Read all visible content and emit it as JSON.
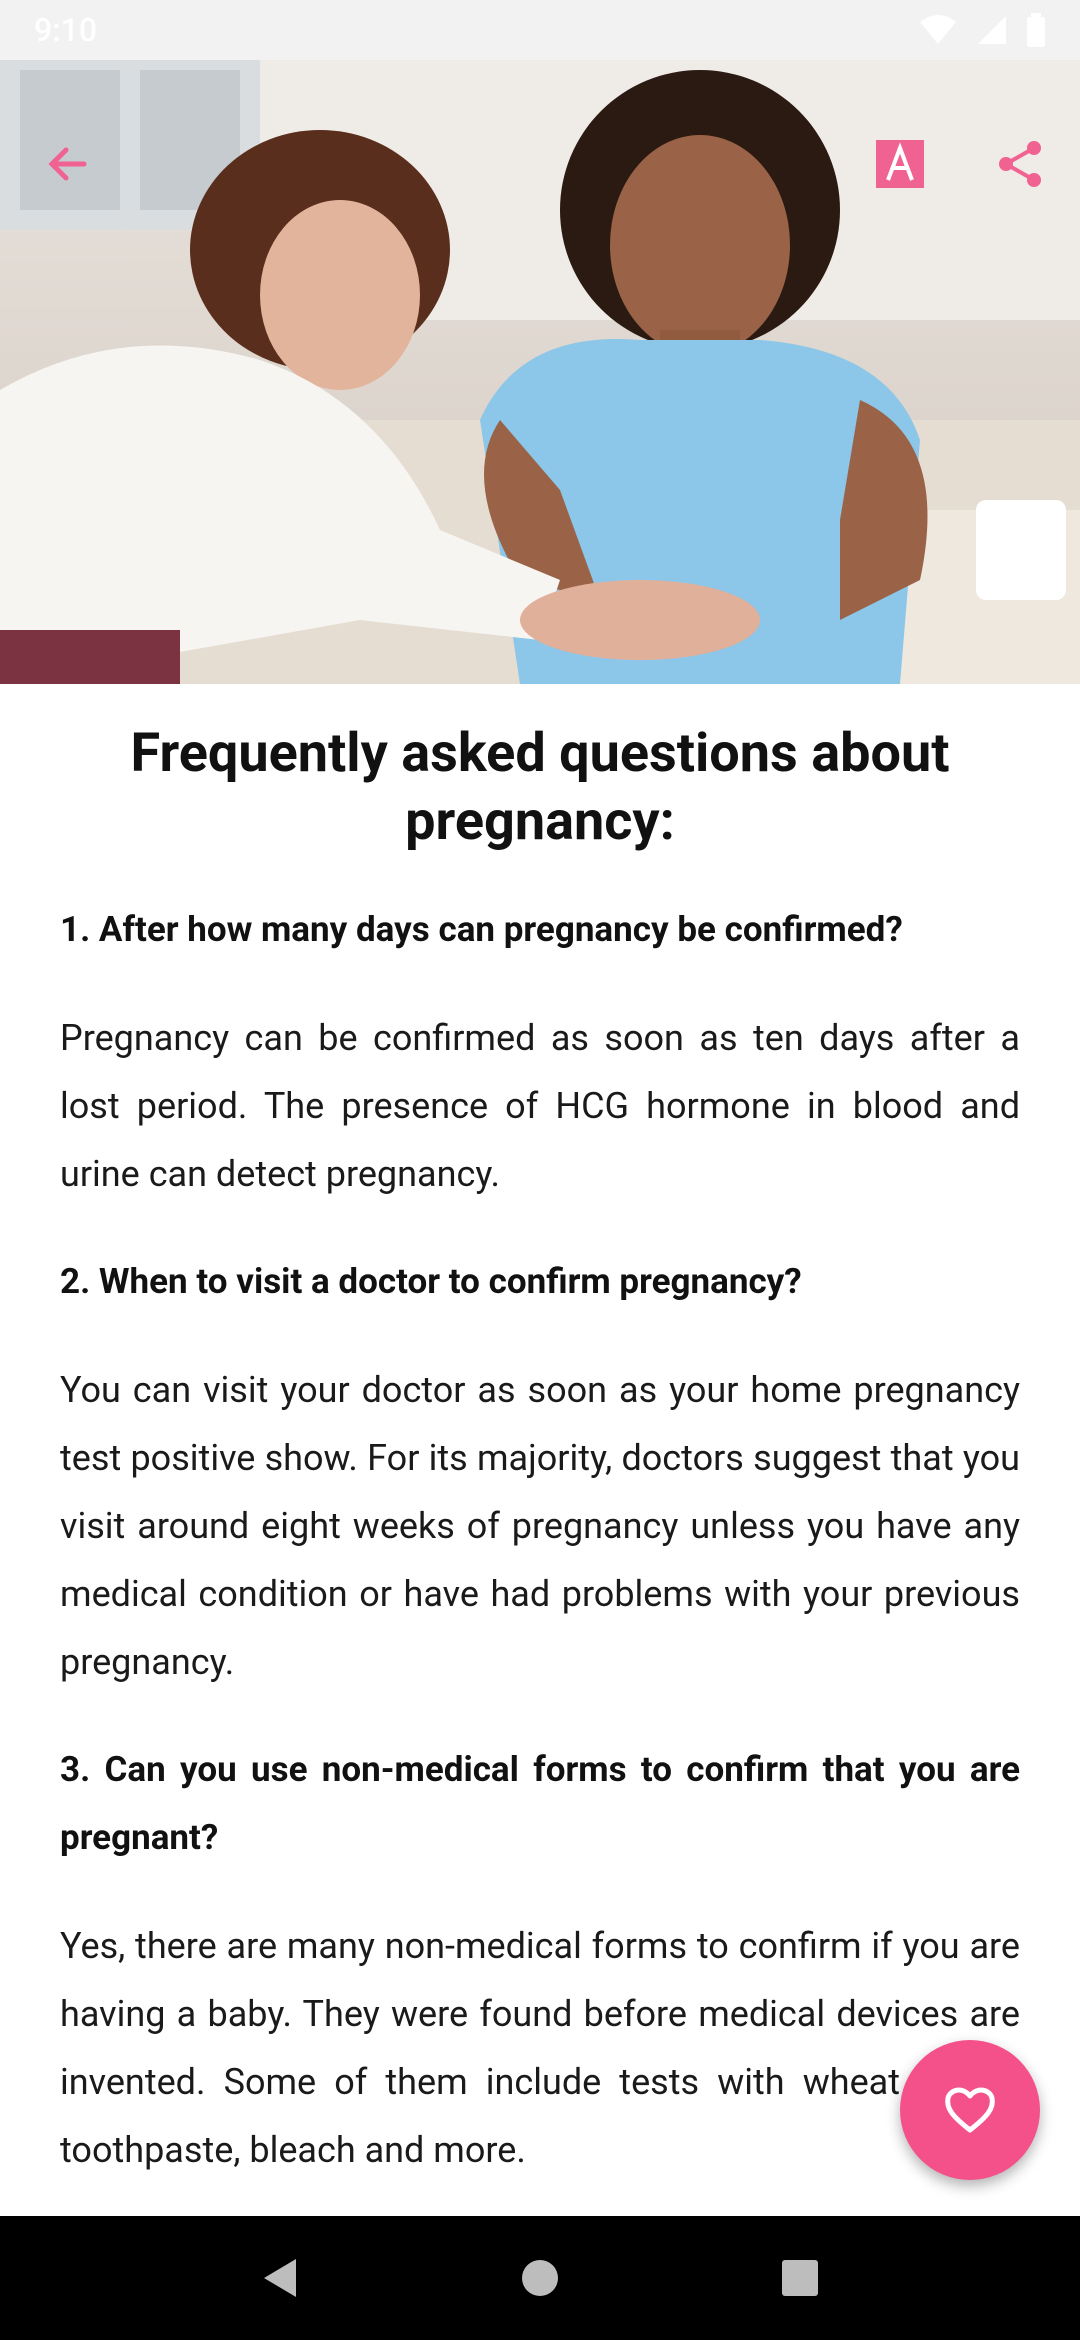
{
  "status_bar": {
    "time": "9:10",
    "icons": [
      "wifi-icon",
      "signal-icon",
      "battery-icon"
    ]
  },
  "hero": {
    "image_alt": "Woman touching pregnant woman's belly",
    "buttons": [
      "back-arrow-icon",
      "font-size-icon",
      "share-icon"
    ],
    "accent_color": "#f06292"
  },
  "article": {
    "title": "Frequently asked questions about pregnancy:",
    "sections": [
      {
        "question": "1. After how many days can pregnancy be confirmed?",
        "answer": "Pregnancy can be confirmed as soon as ten days after a lost period. The presence of HCG hormone in blood and urine can detect pregnancy."
      },
      {
        "question": "2. When to visit a doctor to confirm pregnancy?",
        "answer": "You can visit your doctor as soon as your home pregnancy test positive show. For its majority, doctors suggest that you visit around eight weeks of pregnancy unless you have any medical condition or have had problems with your previous pregnancy."
      },
      {
        "question": "3. Can you use non-medical forms to confirm that you are pregnant?",
        "answer": "Yes, there are many non-medical forms to confirm if you are having a baby. They were found before medical devices are invented. Some of them include tests with wheat barley, toothpaste, bleach and more."
      }
    ]
  },
  "fab": {
    "icon": "heart-outline-icon",
    "color": "#f4508a"
  },
  "nav_bar": {
    "buttons": [
      "back-triangle-icon",
      "home-circle-icon",
      "recents-square-icon"
    ]
  }
}
